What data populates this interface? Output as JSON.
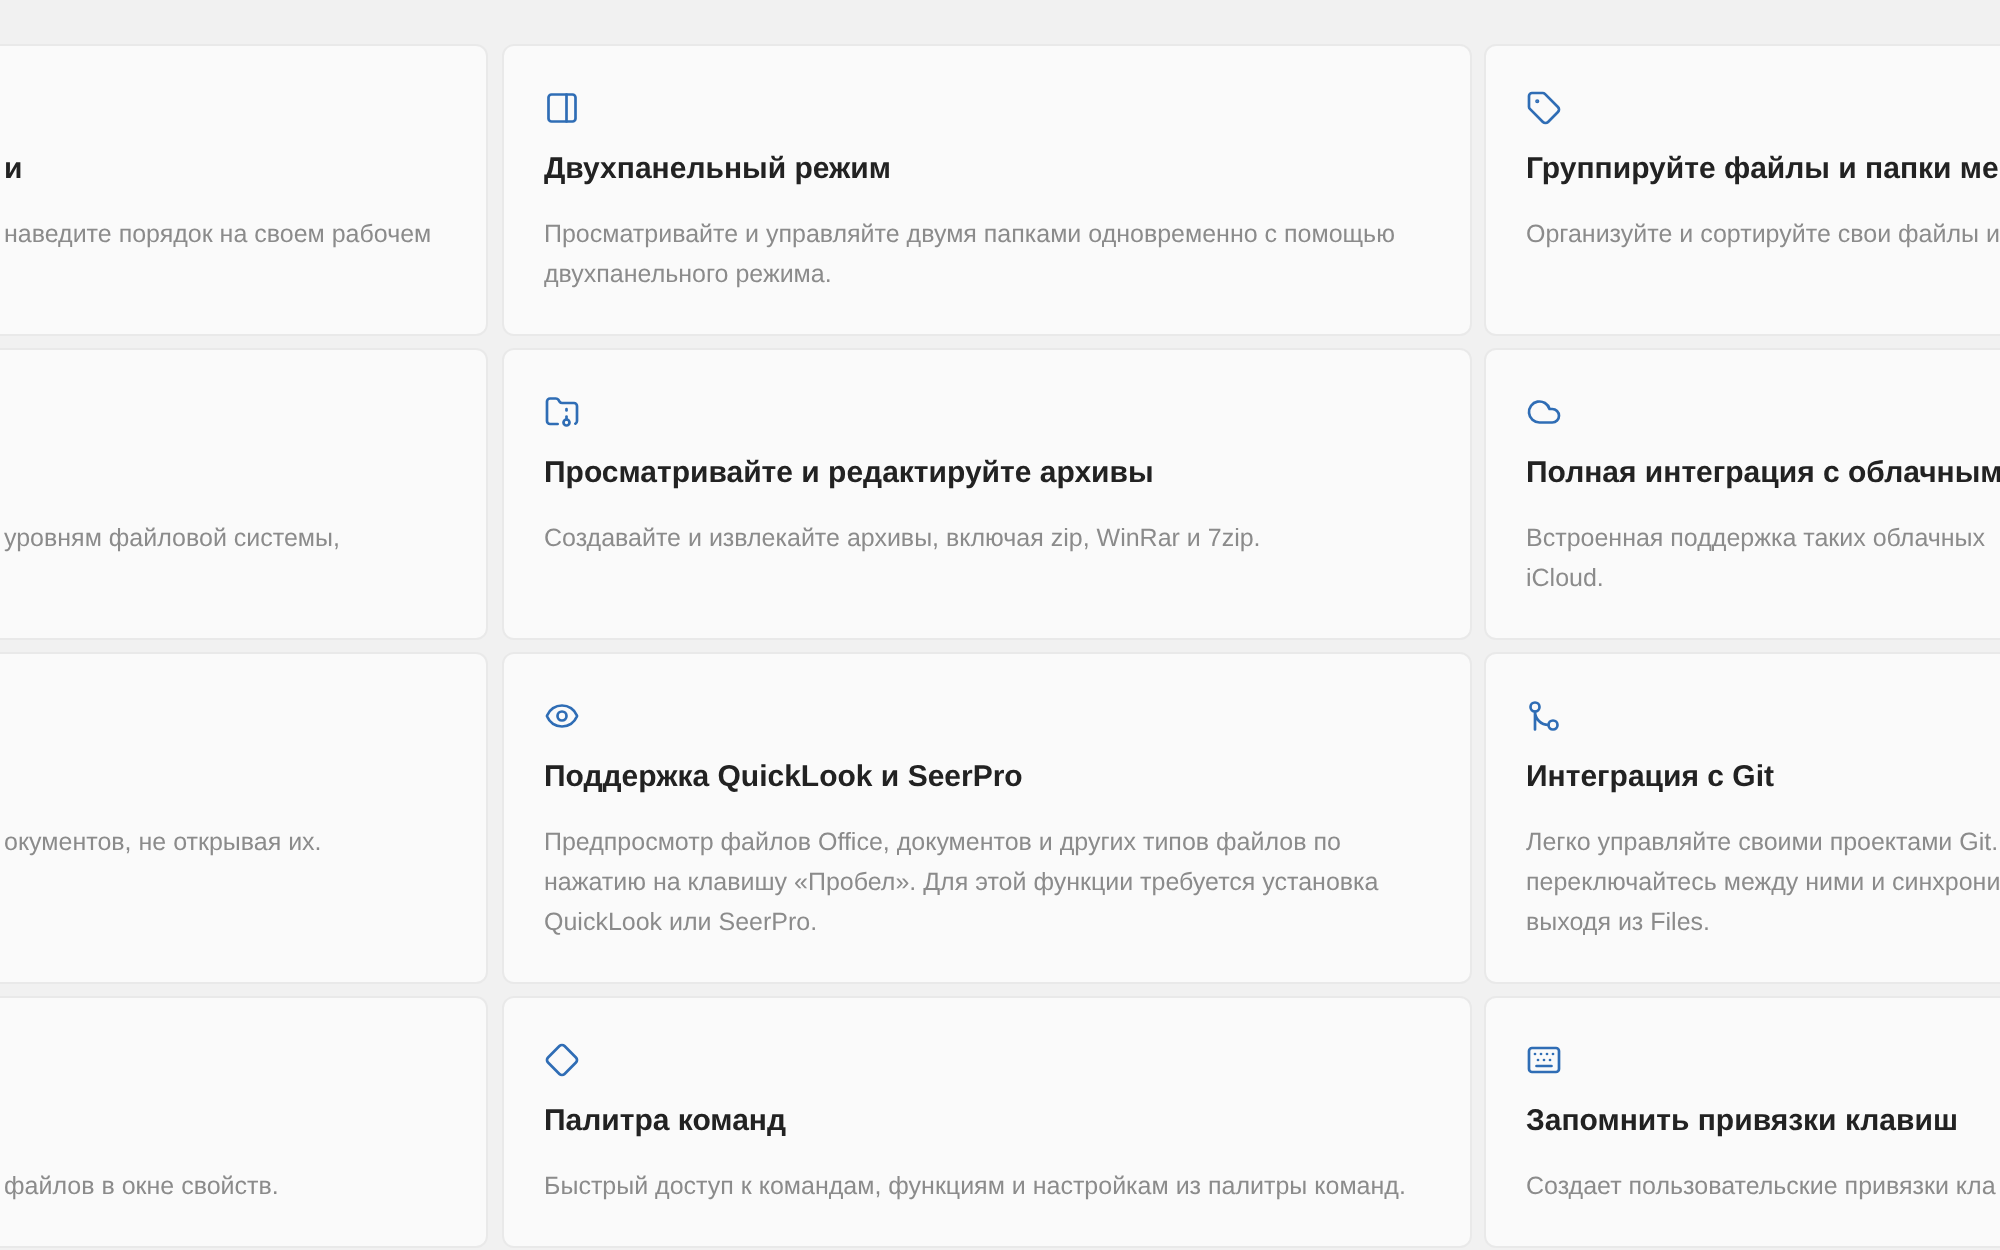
{
  "rows": [
    {
      "cards": [
        {
          "kind": "clipped_left",
          "title": "и",
          "lines": [
            "наведите порядок на своем рабочем"
          ]
        },
        {
          "kind": "full",
          "title": "Двухпанельный режим",
          "lines": [
            "Просматривайте и управляйте двумя папками одновременно с помощью",
            "двухпанельного режима."
          ]
        },
        {
          "kind": "clipped_right",
          "title": "Группируйте файлы и папки ме",
          "lines": [
            "Организуйте и сортируйте свои файлы и"
          ]
        }
      ]
    },
    {
      "cards": [
        {
          "kind": "clipped_left",
          "lines": [
            "уровням файловой системы,"
          ]
        },
        {
          "kind": "full",
          "title": "Просматривайте и редактируйте архивы",
          "lines": [
            "Создавайте и извлекайте архивы, включая zip, WinRar и 7zip."
          ]
        },
        {
          "kind": "clipped_right",
          "title": "Полная интеграция с облачным",
          "lines": [
            "Встроенная поддержка таких облачных",
            "iCloud."
          ]
        }
      ]
    },
    {
      "cards": [
        {
          "kind": "clipped_left",
          "lines": [
            "окументов, не открывая их."
          ]
        },
        {
          "kind": "full",
          "title": "Поддержка QuickLook и SeerPro",
          "lines": [
            "Предпросмотр файлов Office, документов и других типов файлов по",
            "нажатию на клавишу «Пробел». Для этой функции требуется установка",
            "QuickLook или SeerPro."
          ]
        },
        {
          "kind": "clipped_right",
          "title": "Интеграция с Git",
          "lines": [
            "Легко управляйте своими проектами Git.",
            "переключайтесь между ними и синхрони",
            "выходя из Files."
          ]
        }
      ]
    },
    {
      "cards": [
        {
          "kind": "clipped_left",
          "lines": [
            "файлов в окне свойств."
          ]
        },
        {
          "kind": "full",
          "title": "Палитра команд",
          "lines": [
            "Быстрый доступ к командам, функциям и настройкам из палитры команд."
          ]
        },
        {
          "kind": "clipped_right",
          "title": "Запомнить привязки клавиш",
          "lines": [
            "Создает пользовательские привязки кла"
          ]
        }
      ]
    }
  ]
}
